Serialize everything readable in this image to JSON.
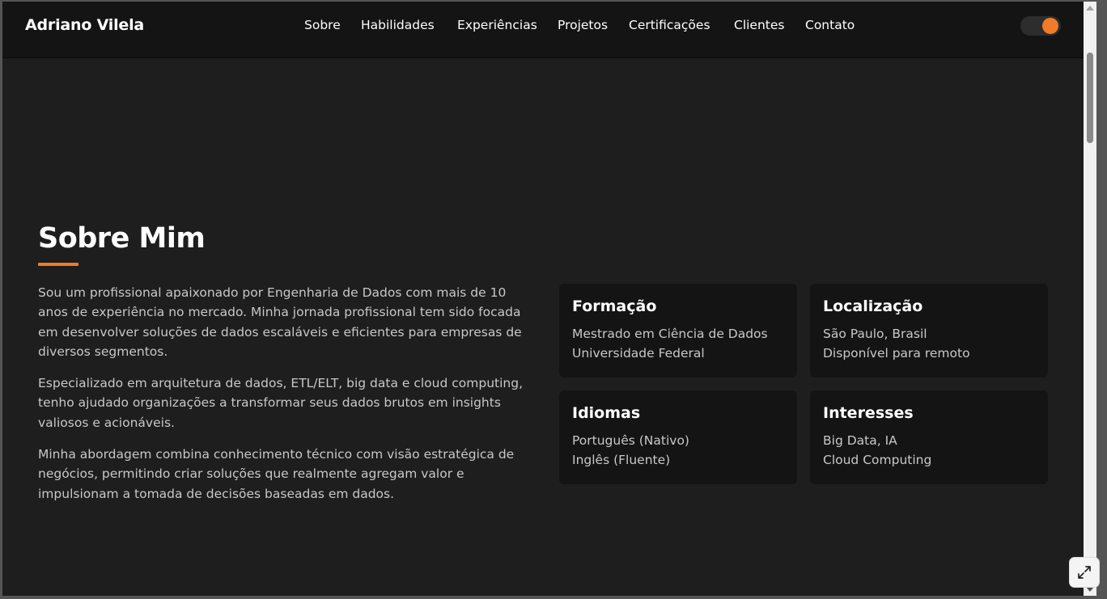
{
  "header": {
    "brand": "Adriano Vilela",
    "nav": [
      "Sobre",
      "Habilidades",
      "Experiências",
      "Projetos",
      "Certificações",
      "Clientes",
      "Contato"
    ],
    "theme_toggle": "dark"
  },
  "about": {
    "title": "Sobre Mim",
    "paragraphs": [
      "Sou um profissional apaixonado por Engenharia de Dados com mais de 10 anos de experiência no mercado. Minha jornada profissional tem sido focada em desenvolver soluções de dados escaláveis e eficientes para empresas de diversos segmentos.",
      "Especializado em arquitetura de dados, ETL/ELT, big data e cloud computing, tenho ajudado organizações a transformar seus dados brutos em insights valiosos e acionáveis.",
      "Minha abordagem combina conhecimento técnico com visão estratégica de negócios, permitindo criar soluções que realmente agregam valor e impulsionam a tomada de decisões baseadas em dados."
    ],
    "cards": [
      {
        "title": "Formação",
        "lines": [
          "Mestrado em Ciência de Dados",
          "Universidade Federal"
        ]
      },
      {
        "title": "Localização",
        "lines": [
          "São Paulo, Brasil",
          "Disponível para remoto"
        ]
      },
      {
        "title": "Idiomas",
        "lines": [
          "Português (Nativo)",
          "Inglês (Fluente)"
        ]
      },
      {
        "title": "Interesses",
        "lines": [
          "Big Data, IA",
          "Cloud Computing"
        ]
      }
    ]
  },
  "colors": {
    "accent": "#f07b28",
    "background": "#1e1e1e",
    "navbar": "#141414",
    "card": "#141414"
  },
  "icons": {
    "expand": "expand-arrows-icon"
  }
}
